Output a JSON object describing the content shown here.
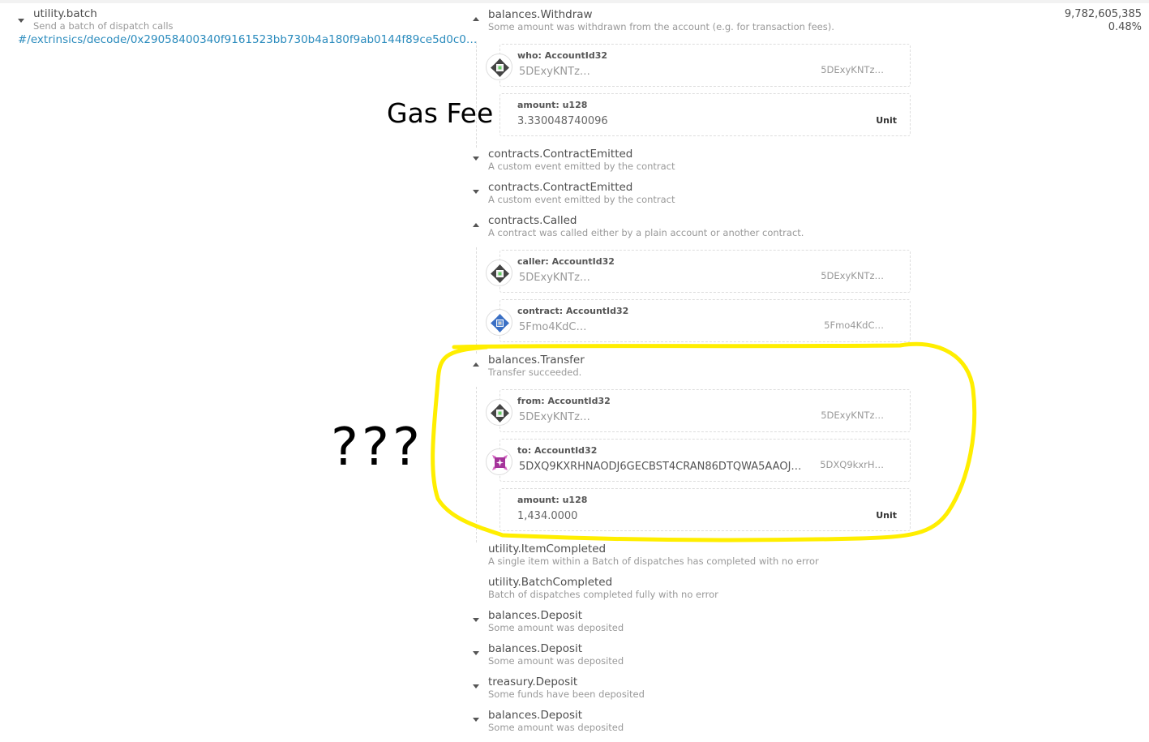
{
  "extrinsic": {
    "title": "utility.batch",
    "desc": "Send a batch of dispatch calls",
    "link": "#/extrinsics/decode/0x29058400340f9161523bb730b4a180f9ab0144f89ce5d0c0…"
  },
  "stats": {
    "weight": "9,782,605,385",
    "percent": "0.48%"
  },
  "events": [
    {
      "title": "balances.Withdraw",
      "desc": "Some amount was withdrawn from the account (e.g. for transaction fees).",
      "expanded": true,
      "params": [
        {
          "label": "who: AccountId32",
          "value": "5DExyKNTz…",
          "right": "5DExyKNTz…",
          "icon": "identicon-gray"
        },
        {
          "label": "amount: u128",
          "value": "3.330048740096",
          "unit": "Unit"
        }
      ]
    },
    {
      "title": "contracts.ContractEmitted",
      "desc": "A custom event emitted by the contract",
      "expanded": false
    },
    {
      "title": "contracts.ContractEmitted",
      "desc": "A custom event emitted by the contract",
      "expanded": false
    },
    {
      "title": "contracts.Called",
      "desc": "A contract was called either by a plain account or another contract.",
      "expanded": true,
      "params": [
        {
          "label": "caller: AccountId32",
          "value": "5DExyKNTz…",
          "right": "5DExyKNTz…",
          "icon": "identicon-gray"
        },
        {
          "label": "contract: AccountId32",
          "value": "5Fmo4KdC…",
          "right": "5Fmo4KdC…",
          "icon": "identicon-blue"
        }
      ]
    },
    {
      "title": "balances.Transfer",
      "desc": "Transfer succeeded.",
      "expanded": true,
      "params": [
        {
          "label": "from: AccountId32",
          "value": "5DExyKNTz…",
          "right": "5DExyKNTz…",
          "icon": "identicon-gray"
        },
        {
          "label": "to: AccountId32",
          "value": "5DXQ9KXRHNAODJ6GECBST4CRAN86DTQWA5AAOJ…",
          "right": "5DXQ9kxrH…",
          "icon": "identicon-pink"
        },
        {
          "label": "amount: u128",
          "value": "1,434.0000",
          "unit": "Unit"
        }
      ]
    },
    {
      "title": "utility.ItemCompleted",
      "desc": "A single item within a Batch of dispatches has completed with no error",
      "expanded": false,
      "nocaret": true
    },
    {
      "title": "utility.BatchCompleted",
      "desc": "Batch of dispatches completed fully with no error",
      "expanded": false,
      "nocaret": true
    },
    {
      "title": "balances.Deposit",
      "desc": "Some amount was deposited",
      "expanded": false
    },
    {
      "title": "balances.Deposit",
      "desc": "Some amount was deposited",
      "expanded": false
    },
    {
      "title": "treasury.Deposit",
      "desc": "Some funds have been deposited",
      "expanded": false
    },
    {
      "title": "balances.Deposit",
      "desc": "Some amount was deposited",
      "expanded": false
    }
  ],
  "annotations": {
    "gas_fee": "Gas Fee",
    "question": "???",
    "highlight_color": "#ffee00"
  }
}
